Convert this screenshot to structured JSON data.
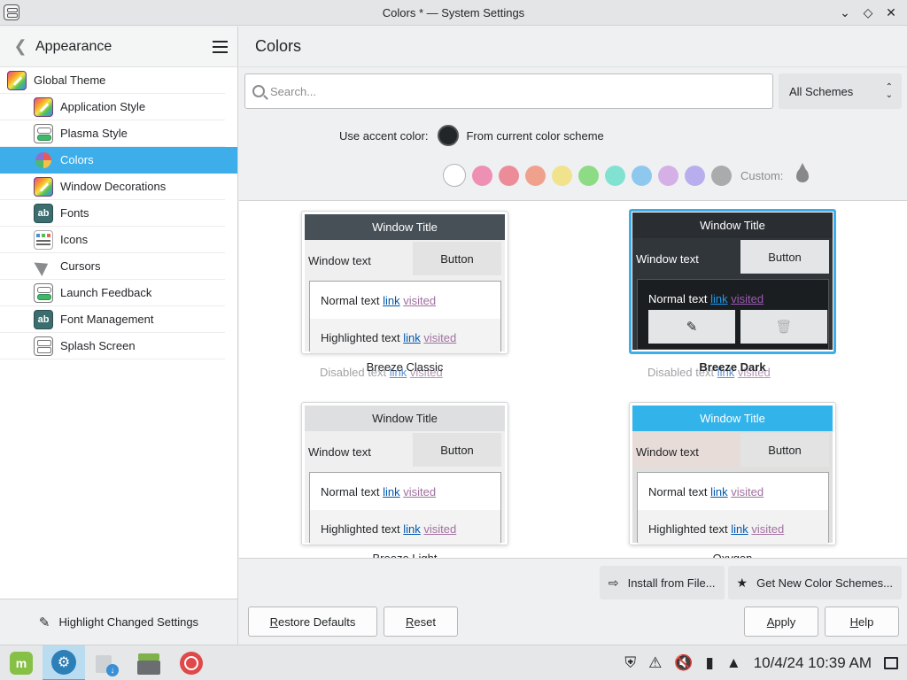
{
  "window": {
    "title": "Colors * — System Settings"
  },
  "sidebar": {
    "back_label": "Appearance",
    "items": [
      {
        "label": "Global Theme",
        "icon": "global-theme-icon"
      },
      {
        "label": "Application Style",
        "icon": "application-style-icon"
      },
      {
        "label": "Plasma Style",
        "icon": "plasma-style-icon"
      },
      {
        "label": "Colors",
        "icon": "colors-icon",
        "active": true
      },
      {
        "label": "Window Decorations",
        "icon": "window-decorations-icon"
      },
      {
        "label": "Fonts",
        "icon": "fonts-icon"
      },
      {
        "label": "Icons",
        "icon": "icons-icon"
      },
      {
        "label": "Cursors",
        "icon": "cursors-icon"
      },
      {
        "label": "Launch Feedback",
        "icon": "launch-feedback-icon"
      },
      {
        "label": "Font Management",
        "icon": "font-management-icon"
      },
      {
        "label": "Splash Screen",
        "icon": "splash-screen-icon"
      }
    ],
    "footer_label": "Highlight Changed Settings"
  },
  "main": {
    "title": "Colors",
    "search_placeholder": "Search...",
    "scheme_filter": "All Schemes",
    "accent_label": "Use accent color:",
    "accent_option": "From current color scheme",
    "custom_label": "Custom:",
    "swatches": [
      "#ffffff",
      "#ee8fb4",
      "#ec8c98",
      "#f0a18d",
      "#f1e38e",
      "#8ddb85",
      "#82e2d2",
      "#8ec8ef",
      "#d4b0e6",
      "#b8aeee",
      "#a9abad"
    ],
    "accent_color": "#3daee9"
  },
  "preview": {
    "window_title": "Window Title",
    "window_text": "Window text",
    "button": "Button",
    "normal_text": "Normal text",
    "highlighted_text": "Highlighted text",
    "disabled_text": "Disabled text",
    "link": "link",
    "visited": "visited"
  },
  "schemes": [
    {
      "name": "Breeze Classic"
    },
    {
      "name": "Breeze Dark",
      "selected": true
    },
    {
      "name": "Breeze Light"
    },
    {
      "name": "Oxygen"
    }
  ],
  "actions": {
    "install_from_file": "Install from File...",
    "get_new": "Get New Color Schemes...",
    "restore_defaults_pre": "",
    "restore_defaults_ul": "R",
    "restore_defaults_post": "estore Defaults",
    "reset_ul": "R",
    "reset_post": "eset",
    "apply_ul": "A",
    "apply_post": "pply",
    "help_ul": "H",
    "help_post": "elp"
  },
  "taskbar": {
    "clock": "10/4/24 10:39 AM"
  }
}
